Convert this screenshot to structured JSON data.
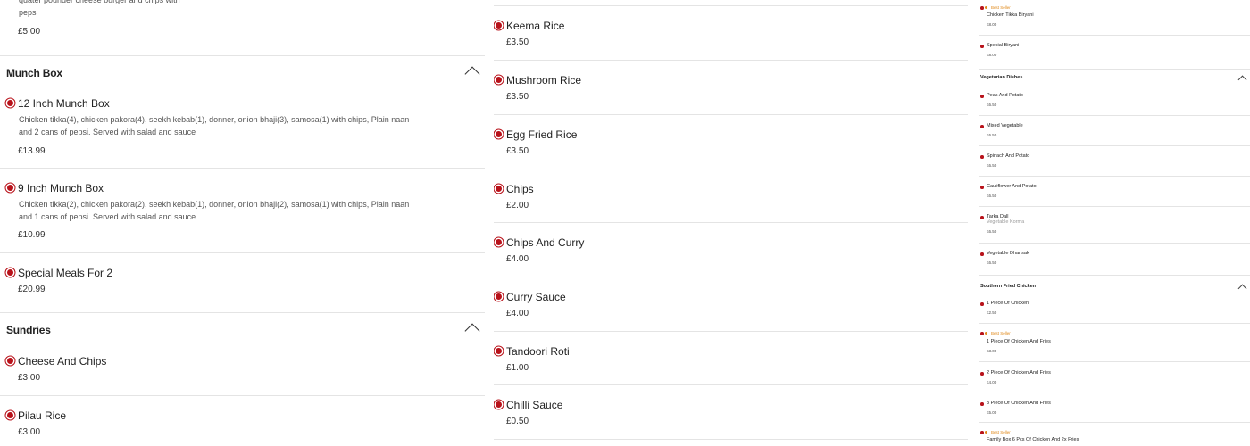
{
  "col1": {
    "top_item": {
      "desc": "quater pounder cheese burger and chips with pepsi",
      "price": "£5.00"
    },
    "munch_box": {
      "title": "Munch Box",
      "items": [
        {
          "name": "12 Inch Munch Box",
          "desc": "Chicken tikka(4), chicken pakora(4), seekh kebab(1), donner, onion bhaji(3), samosa(1) with chips, Plain naan and 2 cans of pepsi. Served with salad and sauce",
          "price": "£13.99"
        },
        {
          "name": "9 Inch Munch Box",
          "desc": "Chicken tikka(2), chicken pakora(2), seekh kebab(1), donner, onion bhaji(2), samosa(1) with chips, Plain naan and 1 cans of pepsi. Served with salad and sauce",
          "price": "£10.99"
        },
        {
          "name": "Special Meals For 2",
          "price": "£20.99"
        }
      ]
    },
    "sundries": {
      "title": "Sundries",
      "items": [
        {
          "name": "Cheese And Chips",
          "price": "£3.00"
        },
        {
          "name": "Pilau Rice",
          "price": "£3.00"
        }
      ]
    }
  },
  "col2": {
    "items": [
      {
        "name": "Keema Rice",
        "price": "£3.50"
      },
      {
        "name": "Mushroom Rice",
        "price": "£3.50"
      },
      {
        "name": "Egg Fried Rice",
        "price": "£3.50"
      },
      {
        "name": "Chips",
        "price": "£2.00"
      },
      {
        "name": "Chips And Curry",
        "price": "£4.00"
      },
      {
        "name": "Curry Sauce",
        "price": "£4.00"
      },
      {
        "name": "Tandoori Roti",
        "price": "£1.00"
      },
      {
        "name": "Chilli Sauce",
        "price": "£0.50"
      }
    ]
  },
  "col3": {
    "biryani_items": [
      {
        "badge": "Best Seller",
        "name": "Chicken Tikka Biryani",
        "price": "£8.00"
      },
      {
        "name": "Special Biryani",
        "price": "£8.00"
      }
    ],
    "vegetarian": {
      "title": "Vegetarian Dishes",
      "items": [
        {
          "name": "Peas And Potato",
          "price": "£6.50"
        },
        {
          "name": "Mixed Vegetable",
          "price": "£6.50"
        },
        {
          "name": "Spinach And Potato",
          "price": "£6.50"
        },
        {
          "name": "Cauliflower And Potato",
          "price": "£6.50"
        },
        {
          "name": "Tarka Dall",
          "overlap": "Vegetable Korma",
          "price": "£6.50"
        },
        {
          "name": "Vegetable Dhansak",
          "price": "£6.50"
        }
      ]
    },
    "southern": {
      "title": "Southern Fried Chicken",
      "items": [
        {
          "name": "1 Piece Of Chicken",
          "price": "£2.50"
        },
        {
          "badge": "Best Seller",
          "name": "1 Piece Of Chicken And Fries",
          "price": "£3.00"
        },
        {
          "name": "2 Piece Of Chicken And Fries",
          "price": "£4.00"
        },
        {
          "name": "3 Piece Of Chicken And Fries",
          "price": "£5.00"
        },
        {
          "badge": "Best Seller",
          "name": "Family Box 6 Pcs Of Chicken And 2x Fries"
        }
      ]
    }
  },
  "colors": {
    "accent_red": "#b8121a",
    "best_seller": "#e0891a",
    "divider": "#e4e4e4"
  },
  "icons": {
    "collapse": "chevron-up-icon",
    "veg_mark": "red-dot-icon",
    "best_seller": "star-dot-icon"
  }
}
